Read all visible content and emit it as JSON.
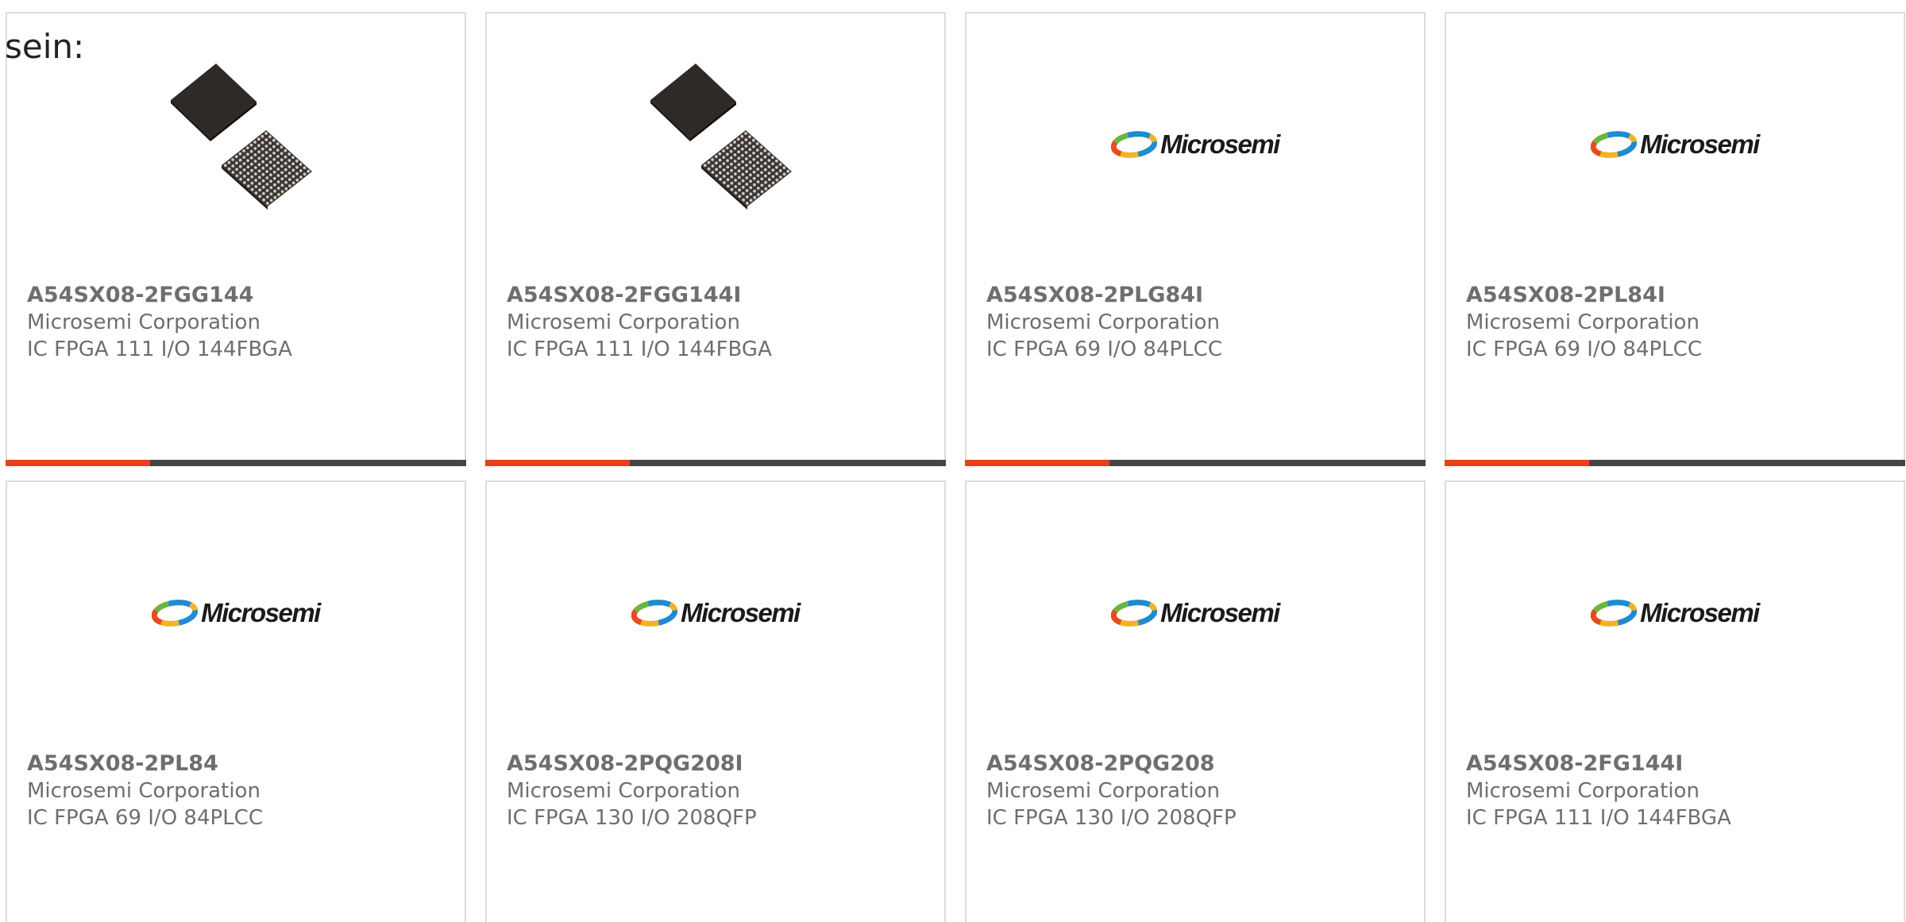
{
  "intro": {
    "text": "sein:"
  },
  "colors": {
    "accent": "#e8401c",
    "bar": "#444444",
    "text": "#6e6e6e",
    "border": "#dcdcdc"
  },
  "logo": {
    "text": "Microsemi"
  },
  "products": [
    {
      "part_number": "A54SX08-2FGG144",
      "manufacturer": "Microsemi Corporation",
      "description": "IC FPGA 111 I/O 144FBGA",
      "image": "chip-bga-icon",
      "show_bar": true
    },
    {
      "part_number": "A54SX08-2FGG144I",
      "manufacturer": "Microsemi Corporation",
      "description": "IC FPGA 111 I/O 144FBGA",
      "image": "chip-bga-icon",
      "show_bar": true
    },
    {
      "part_number": "A54SX08-2PLG84I",
      "manufacturer": "Microsemi Corporation",
      "description": "IC FPGA 69 I/O 84PLCC",
      "image": "microsemi-logo",
      "show_bar": true
    },
    {
      "part_number": "A54SX08-2PL84I",
      "manufacturer": "Microsemi Corporation",
      "description": "IC FPGA 69 I/O 84PLCC",
      "image": "microsemi-logo",
      "show_bar": true
    },
    {
      "part_number": "A54SX08-2PL84",
      "manufacturer": "Microsemi Corporation",
      "description": "IC FPGA 69 I/O 84PLCC",
      "image": "microsemi-logo",
      "show_bar": false
    },
    {
      "part_number": "A54SX08-2PQG208I",
      "manufacturer": "Microsemi Corporation",
      "description": "IC FPGA 130 I/O 208QFP",
      "image": "microsemi-logo",
      "show_bar": false
    },
    {
      "part_number": "A54SX08-2PQG208",
      "manufacturer": "Microsemi Corporation",
      "description": "IC FPGA 130 I/O 208QFP",
      "image": "microsemi-logo",
      "show_bar": false
    },
    {
      "part_number": "A54SX08-2FG144I",
      "manufacturer": "Microsemi Corporation",
      "description": "IC FPGA 111 I/O 144FBGA",
      "image": "microsemi-logo",
      "show_bar": false
    }
  ]
}
